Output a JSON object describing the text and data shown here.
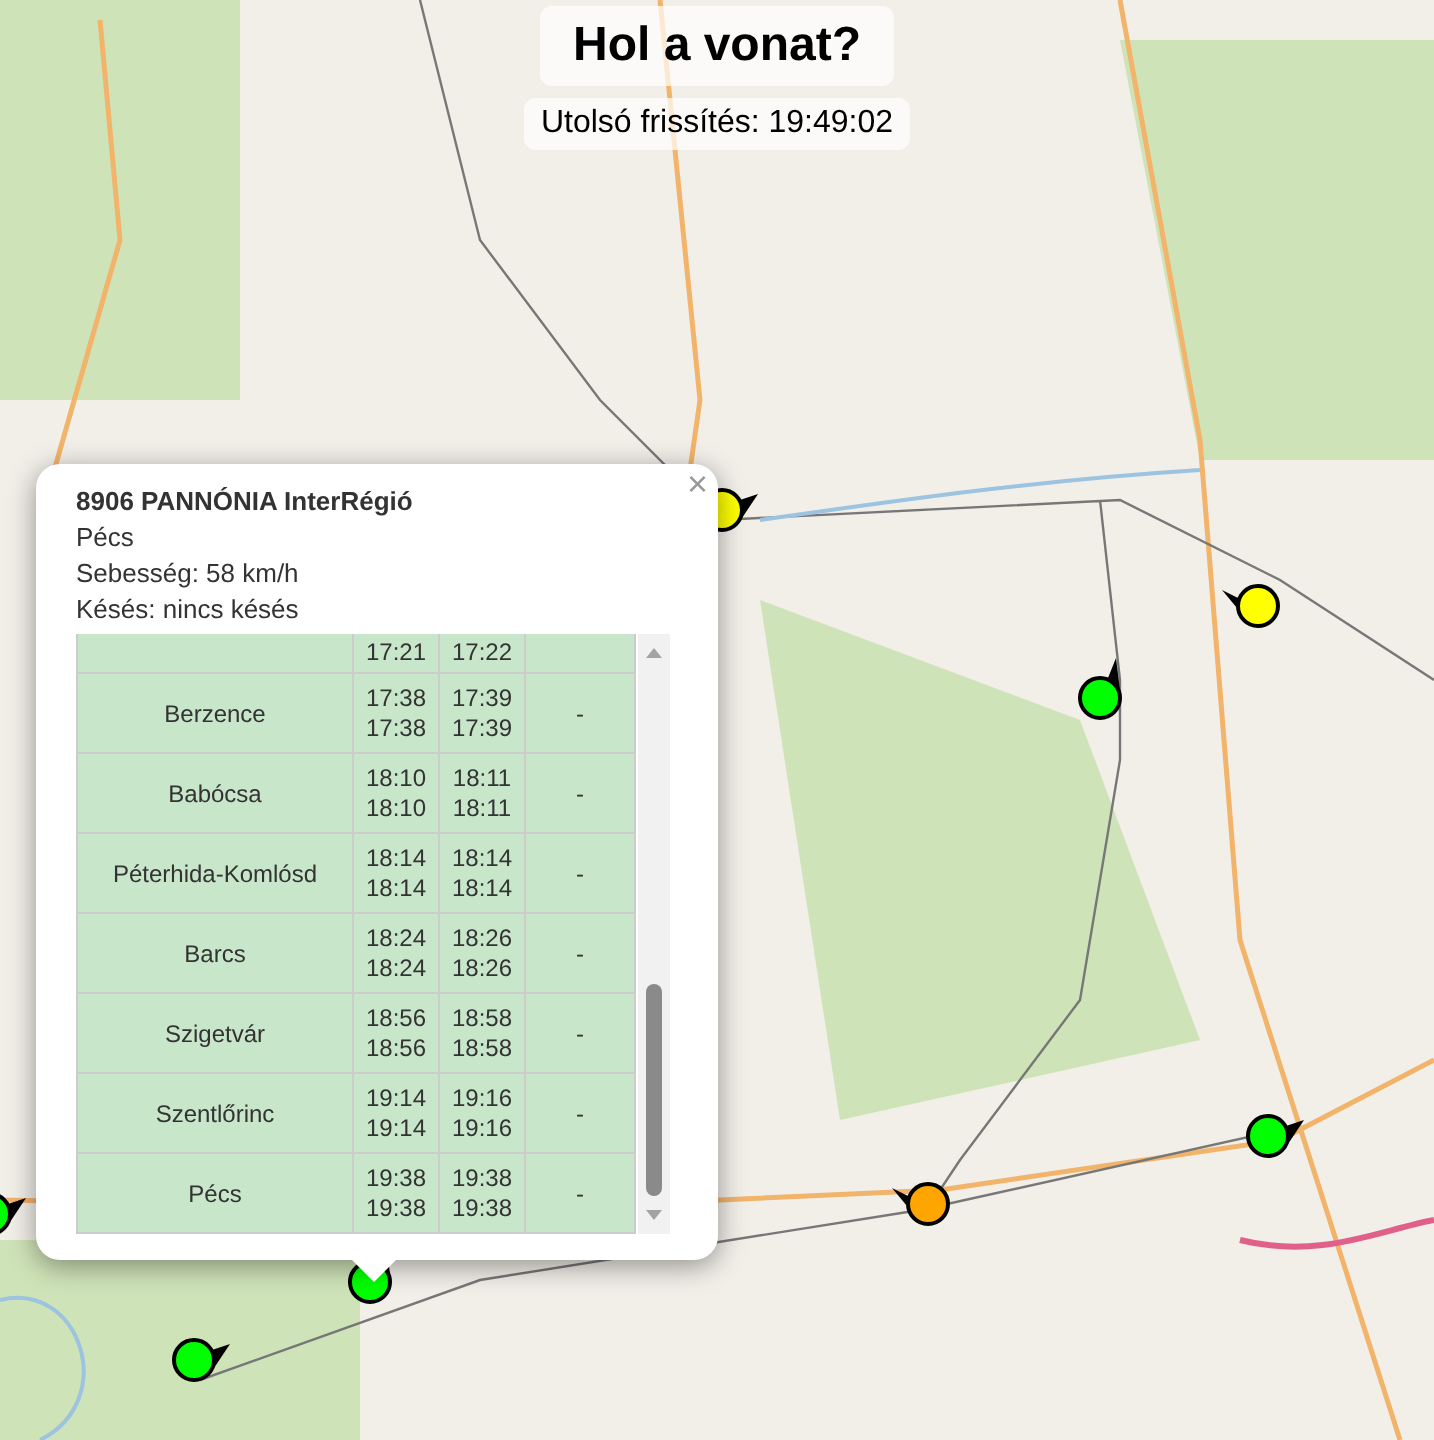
{
  "header": {
    "title": "Hol a vonat?",
    "last_update": "Utolsó frissítés: 19:49:02"
  },
  "markers": [
    {
      "color": "#ffff00"
    },
    {
      "color": "#ffff00"
    },
    {
      "color": "#00ff00"
    },
    {
      "color": "#00ff00"
    },
    {
      "color": "#ffa500"
    },
    {
      "color": "#00ff00"
    },
    {
      "color": "#00ff00"
    },
    {
      "color": "#00ff00"
    }
  ],
  "popup": {
    "close": "×",
    "train": "8906 PANNÓNIA InterRégió",
    "destination": "Pécs",
    "speed": "Sebesség: 58 km/h",
    "delay": "Késés: nincs késés",
    "rows": [
      {
        "arrival": [
          "17:21"
        ],
        "departure": [
          "17:22"
        ]
      },
      {
        "station": "Berzence",
        "arrival": [
          "17:38",
          "17:38"
        ],
        "departure": [
          "17:39",
          "17:39"
        ],
        "delay": "-"
      },
      {
        "station": "Babócsa",
        "arrival": [
          "18:10",
          "18:10"
        ],
        "departure": [
          "18:11",
          "18:11"
        ],
        "delay": "-"
      },
      {
        "station": "Péterhida-Komlósd",
        "arrival": [
          "18:14",
          "18:14"
        ],
        "departure": [
          "18:14",
          "18:14"
        ],
        "delay": "-"
      },
      {
        "station": "Barcs",
        "arrival": [
          "18:24",
          "18:24"
        ],
        "departure": [
          "18:26",
          "18:26"
        ],
        "delay": "-"
      },
      {
        "station": "Szigetvár",
        "arrival": [
          "18:56",
          "18:56"
        ],
        "departure": [
          "18:58",
          "18:58"
        ],
        "delay": "-"
      },
      {
        "station": "Szentlőrinc",
        "arrival": [
          "19:14",
          "19:14"
        ],
        "departure": [
          "19:16",
          "19:16"
        ],
        "delay": "-"
      },
      {
        "station": "Pécs",
        "arrival": [
          "19:38",
          "19:38"
        ],
        "departure": [
          "19:38",
          "19:38"
        ],
        "delay": "-"
      }
    ]
  }
}
